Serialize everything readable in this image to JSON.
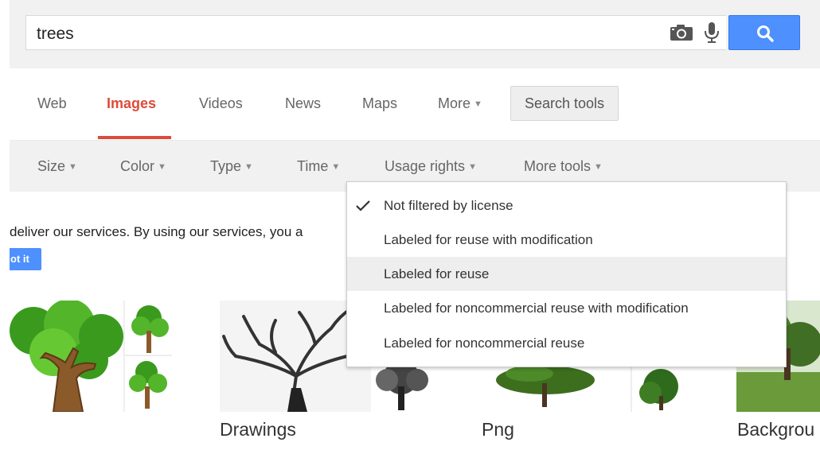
{
  "search": {
    "query": "trees"
  },
  "icons": {
    "camera": "camera-icon",
    "mic": "microphone-icon",
    "search": "magnifier-icon",
    "check": "check-icon"
  },
  "colors": {
    "accent_blue": "#4d90fe",
    "active_red": "#dd4b39",
    "header_bg": "#f1f1f1"
  },
  "nav": {
    "tabs": [
      {
        "label": "Web"
      },
      {
        "label": "Images",
        "active": true
      },
      {
        "label": "Videos"
      },
      {
        "label": "News"
      },
      {
        "label": "Maps"
      },
      {
        "label": "More"
      }
    ],
    "search_tools": "Search tools"
  },
  "tools": {
    "items": [
      {
        "label": "Size"
      },
      {
        "label": "Color"
      },
      {
        "label": "Type"
      },
      {
        "label": "Time"
      },
      {
        "label": "Usage rights"
      },
      {
        "label": "More tools"
      }
    ]
  },
  "usage_dropdown": {
    "options": [
      {
        "label": "Not filtered by license",
        "checked": true
      },
      {
        "label": "Labeled for reuse with modification"
      },
      {
        "label": "Labeled for reuse",
        "highlighted": true
      },
      {
        "label": "Labeled for noncommercial reuse with modification"
      },
      {
        "label": "Labeled for noncommercial reuse"
      }
    ]
  },
  "cookie_notice": {
    "text": "deliver our services. By using our services, you a",
    "button": "ot it"
  },
  "results": {
    "captions": [
      "Drawings",
      "Png",
      "Backgrou"
    ]
  }
}
